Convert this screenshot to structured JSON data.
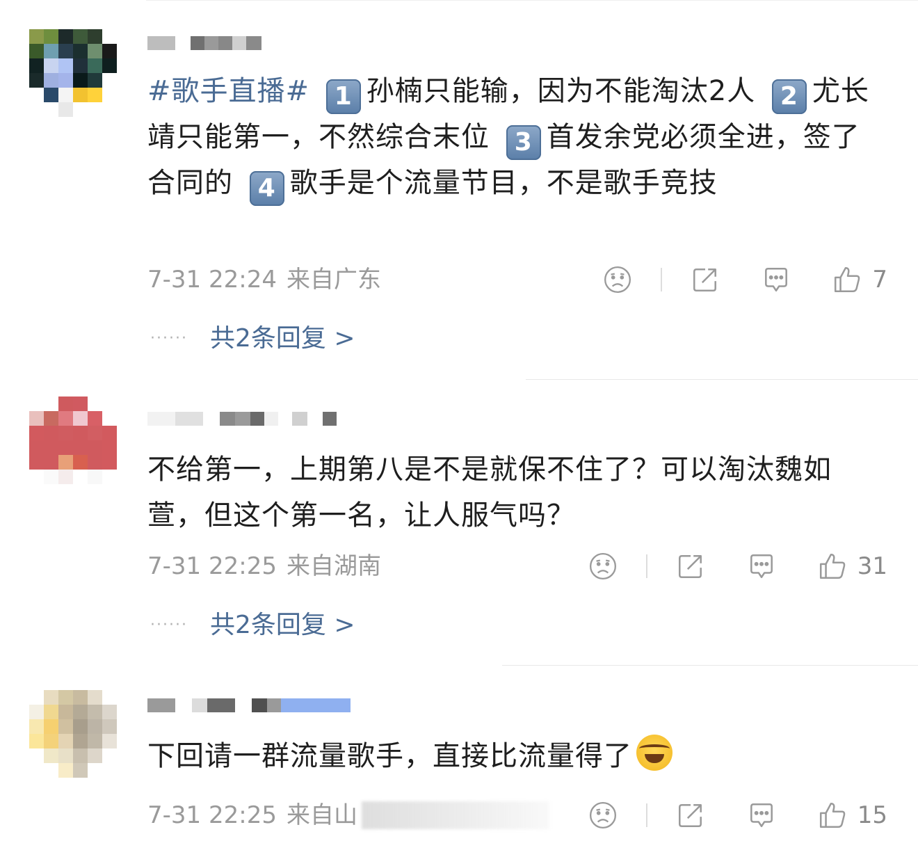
{
  "comments": [
    {
      "hashtag": "#歌手直播#",
      "segments": [
        {
          "badge": "1",
          "text": "孙楠只能输，因为不能淘汰2人"
        },
        {
          "badge": "2",
          "text": "尤长靖只能第一，不然综合末位"
        },
        {
          "badge": "3",
          "text": "首发余党必须全进，签了合同的"
        },
        {
          "badge": "4",
          "text": "歌手是个流量节目，不是歌手竞技"
        }
      ],
      "time": "7-31 22:24",
      "location": "来自广东",
      "likes": "7",
      "replies_label": "共2条回复 >",
      "avatar_colors": [
        "#8a9a4a",
        "#6e8e3e",
        "#1d2a2a",
        "#3e5a3a",
        "#2e3e2e",
        "#ffffff",
        "#3a5a2a",
        "#6f9fb0",
        "#2a3f4f",
        "#1b2f2f",
        "#6f8f6f",
        "#1a1a1a",
        "#112222",
        "#c8d4f0",
        "#b0c4f4",
        "#20303a",
        "#3a6a5a",
        "#0f1f1f",
        "#1a2a2a",
        "#9fb0e0",
        "#a4b4ea",
        "#0a1a1a",
        "#203a3a",
        "#ffffff",
        "#ffffff",
        "#2a4a6a",
        "#f4f4f4",
        "#f2c230",
        "#ffd23a",
        "#ffffff",
        "#ffffff",
        "#ffffff",
        "#e8e8e8",
        "#ffffff",
        "#ffffff",
        "#ffffff"
      ]
    },
    {
      "text": "不给第一，上期第八是不是就保不住了？可以淘汰魏如萱，但这个第一名，让人服气吗？",
      "time": "7-31 22:25",
      "location": "来自湖南",
      "likes": "31",
      "replies_label": "共2条回复 >",
      "avatar_colors": [
        "#ffffff",
        "#ffffff",
        "#cf5a5e",
        "#d05a60",
        "#ffffff",
        "#ffffff",
        "#e9c0bd",
        "#c86a60",
        "#e07a80",
        "#f0c8d0",
        "#d86066",
        "#ffffff",
        "#d25a5e",
        "#d05a5e",
        "#d05c60",
        "#d05a5e",
        "#d25e62",
        "#d25a5e",
        "#d05a5e",
        "#d05a5e",
        "#d05a5e",
        "#d05a5e",
        "#d05a5e",
        "#d25a5e",
        "#d05a5e",
        "#d05a5e",
        "#e8a078",
        "#d8604f",
        "#d05a5e",
        "#d25a5e",
        "#ffffff",
        "#fafafa",
        "#f5ecec",
        "#ffffff",
        "#f8f8f8",
        "#ffffff"
      ]
    },
    {
      "text": "下回请一群流量歌手，直接比流量得了",
      "time": "7-31 22:25",
      "location": "来自山",
      "likes": "15",
      "avatar_colors": [
        "#ffffff",
        "#e8dcc0",
        "#d4c8a4",
        "#c8bba0",
        "#e4dccc",
        "#ffffff",
        "#f4f0e4",
        "#f0d890",
        "#c8b89a",
        "#b4aa96",
        "#c4bcac",
        "#dcd6cc",
        "#f8e8b0",
        "#f6d070",
        "#d0c0a0",
        "#a89e8c",
        "#bcb4a6",
        "#cfc8bc",
        "#fbe69a",
        "#f4d27a",
        "#e4d4b4",
        "#b0a592",
        "#c0b8a8",
        "#e8e2d8",
        "#ffffff",
        "#f0e8c8",
        "#e8e0c8",
        "#c8bfae",
        "#ddd6ca",
        "#ffffff",
        "#ffffff",
        "#ffffff",
        "#f8ecc8",
        "#d0c8b8",
        "#ffffff",
        "#ffffff"
      ]
    }
  ],
  "icons": {
    "sad": "sad-face-icon",
    "share": "share-icon",
    "comment": "comment-icon",
    "like": "thumbs-up-icon"
  }
}
